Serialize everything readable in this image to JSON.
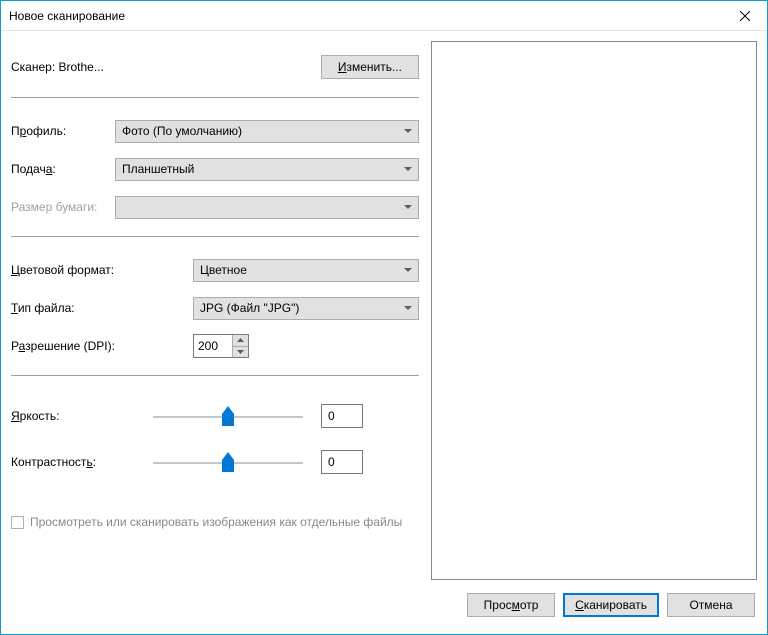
{
  "title": "Новое сканирование",
  "scanner": {
    "label": "Сканер: Brothe...",
    "change": "Изменить..."
  },
  "profile": {
    "label": "Профиль:",
    "underline": "р",
    "value": "Фото (По умолчанию)"
  },
  "source": {
    "label": "Подач",
    "underline": "а",
    "suffix": ":",
    "value": "Планшетный"
  },
  "paperSize": {
    "label": "Размер бумаги:",
    "value": ""
  },
  "colorFormat": {
    "prefix": "",
    "underline": "Ц",
    "label": "ветовой формат:",
    "value": "Цветное"
  },
  "fileType": {
    "underline": "Т",
    "label": "ип файла:",
    "value": "JPG (Файл \"JPG\")"
  },
  "resolution": {
    "label": "Р",
    "underlineChar": "а",
    "rest": "зрешение (DPI):",
    "value": "200"
  },
  "brightness": {
    "underline": "Я",
    "label": "ркость:",
    "value": "0"
  },
  "contrast": {
    "label": "Контрастност",
    "underline": "ь",
    "suffix": ":",
    "value": "0"
  },
  "separateFiles": {
    "label": "Просмотреть или сканировать изображения как отдельные файлы"
  },
  "buttons": {
    "preview": "Просмотр",
    "scan": "Сканировать",
    "cancel": "Отмена"
  }
}
